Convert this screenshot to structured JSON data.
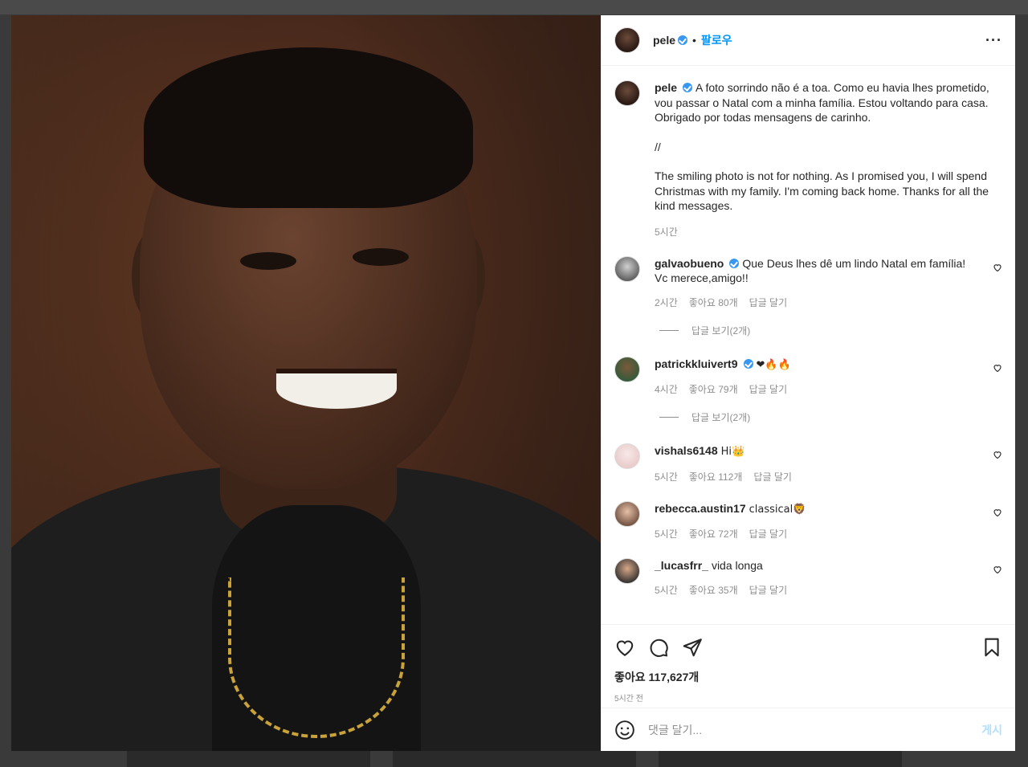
{
  "post": {
    "author": "pele",
    "follow_label": "팔로우",
    "more_icon": "more-horizontal-icon",
    "caption_pt": "A foto sorrindo não é a toa. Como eu havia lhes prometido, vou passar o Natal com a minha família. Estou voltando para casa. Obrigado por todas mensagens de carinho.",
    "caption_sep": "//",
    "caption_en": "The smiling photo is not for nothing. As I promised you, I will spend Christmas with my family. I'm coming back home. Thanks for all the kind messages.",
    "caption_time": "5시간",
    "likes": "좋아요 117,627개",
    "posted_ago": "5시간 전"
  },
  "comments": [
    {
      "user": "galvaobueno",
      "verified": true,
      "text": "Que Deus lhes dê um lindo Natal em família! Vc merece,amigo!!",
      "time": "2시간",
      "likes": "좋아요 80개",
      "reply": "답글 달기",
      "view_replies": "답글 보기(2개)"
    },
    {
      "user": "patrickkluivert9",
      "verified": true,
      "text": "❤🔥🔥",
      "time": "4시간",
      "likes": "좋아요 79개",
      "reply": "답글 달기",
      "view_replies": "답글 보기(2개)"
    },
    {
      "user": "vishals6148",
      "verified": false,
      "text": "Hi👑",
      "time": "5시간",
      "likes": "좋아요 112개",
      "reply": "답글 달기"
    },
    {
      "user": "rebecca.austin17",
      "verified": false,
      "text": "classical🦁",
      "time": "5시간",
      "likes": "좋아요 72개",
      "reply": "답글 달기"
    },
    {
      "user": "_lucasfrr_",
      "verified": false,
      "text": "vida longa",
      "time": "5시간",
      "likes": "좋아요 35개",
      "reply": "답글 달기"
    }
  ],
  "composer": {
    "placeholder": "댓글 달기...",
    "post_label": "게시"
  },
  "colors": {
    "accent": "#0095f6",
    "verified": "#3897f0",
    "muted": "#8e8e8e"
  }
}
